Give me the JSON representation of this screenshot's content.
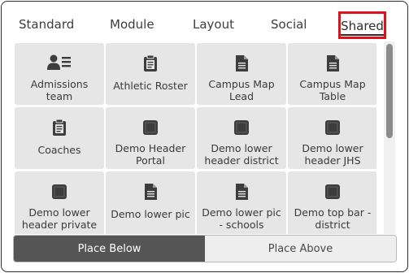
{
  "tabs": [
    {
      "label": "Standard"
    },
    {
      "label": "Module"
    },
    {
      "label": "Layout"
    },
    {
      "label": "Social"
    },
    {
      "label": "Shared"
    }
  ],
  "active_tab": "Shared",
  "tiles": [
    {
      "label": "Admissions team",
      "icon": "users-list-icon"
    },
    {
      "label": "Athletic Roster",
      "icon": "clipboard-icon"
    },
    {
      "label": "Campus Map Lead",
      "icon": "document-icon"
    },
    {
      "label": "Campus Map Table",
      "icon": "document-icon"
    },
    {
      "label": "Coaches",
      "icon": "clipboard-icon"
    },
    {
      "label": "Demo Header Portal",
      "icon": "square-icon"
    },
    {
      "label": "Demo lower header district",
      "icon": "square-icon"
    },
    {
      "label": "Demo lower header JHS",
      "icon": "square-icon"
    },
    {
      "label": "Demo lower header private",
      "icon": "square-icon"
    },
    {
      "label": "Demo lower pic",
      "icon": "document-icon"
    },
    {
      "label": "Demo lower pic - schools",
      "icon": "document-icon"
    },
    {
      "label": "Demo top bar - district",
      "icon": "square-icon"
    }
  ],
  "placement": {
    "below_label": "Place Below",
    "above_label": "Place Above",
    "selected": "Place Below"
  },
  "colors": {
    "highlight": "#e0111a",
    "tile_bg": "#e6e6e6",
    "selected_bg": "#555555"
  }
}
